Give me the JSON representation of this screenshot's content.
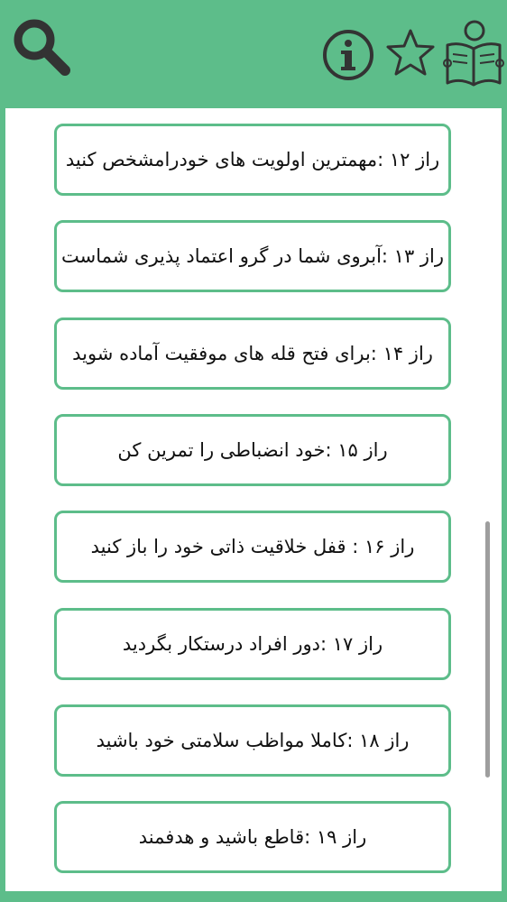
{
  "header": {
    "icons": [
      "search-icon",
      "info-icon",
      "star-icon",
      "book-reader-icon"
    ]
  },
  "colors": {
    "accent": "#5dbd8a",
    "icon": "#333333",
    "background": "#ffffff"
  },
  "list": {
    "items": [
      {
        "label": "راز ۱۲ :مهمترین اولویت های خودرامشخص کنید"
      },
      {
        "label": "راز ۱۳ :آبروی شما در گرو اعتماد پذیری شماست"
      },
      {
        "label": "راز ۱۴ :برای فتح قله های موفقیت آماده شوید"
      },
      {
        "label": "راز ۱۵ :خود انضباطی را تمرین کن"
      },
      {
        "label": "راز ۱۶ : قفل خلاقیت ذاتی خود را باز کنید"
      },
      {
        "label": "راز ۱۷ :دور افراد درستکار بگردید"
      },
      {
        "label": "راز ۱۸ :کاملا مواظب سلامتی خود باشید"
      },
      {
        "label": "راز ۱۹ :قاطع باشید و هدفمند"
      }
    ]
  }
}
